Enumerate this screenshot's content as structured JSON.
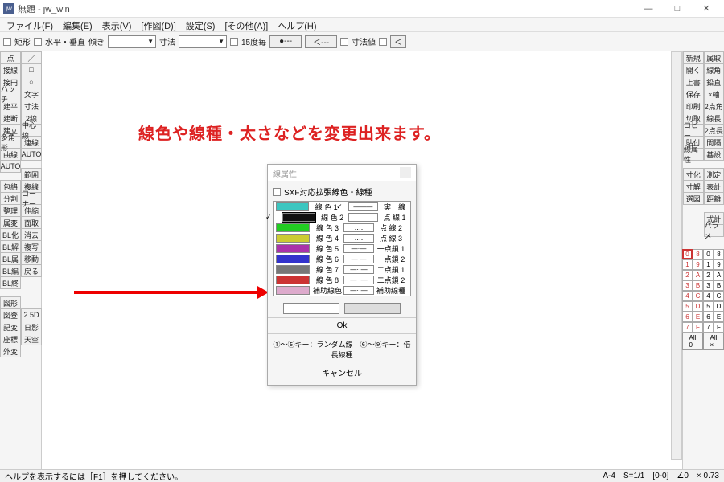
{
  "window": {
    "icon": "jw",
    "title": "無題 - jw_win"
  },
  "menu": [
    "ファイル(F)",
    "編集(E)",
    "表示(V)",
    "[作図(D)]",
    "設定(S)",
    "[その他(A)]",
    "ヘルプ(H)"
  ],
  "optbar": {
    "rect": "矩形",
    "hv": "水平・垂直",
    "slope": "傾き",
    "dim": "寸法",
    "deg15": "15度毎",
    "dimval": "寸法値"
  },
  "left_a": [
    "点",
    "接線",
    "接円",
    "ハッチ",
    "建平",
    "建断",
    "建立",
    "多角形",
    "曲線",
    "AUTO",
    "",
    "包絡",
    "分割",
    "整理",
    "属変",
    "BL化",
    "BL解",
    "BL属",
    "BL編",
    "BL終",
    "",
    "図形",
    "図登",
    "記変",
    "座標",
    "外変"
  ],
  "left_b": [
    "／",
    "□",
    "○",
    "文字",
    "寸法",
    "2線",
    "中心線",
    "連線",
    "AUTO",
    "",
    "範囲",
    "複線",
    "コーナー",
    "伸縮",
    "面取",
    "消去",
    "複写",
    "移動",
    "戻る",
    "",
    "",
    "",
    "",
    "2.5D",
    "日影",
    "天空"
  ],
  "right_a": [
    "新規",
    "開く",
    "上書",
    "保存",
    "印刷",
    "切取",
    "コピー",
    "貼付",
    "線属性",
    "",
    "寸化",
    "寸解",
    "選図",
    "",
    "",
    "",
    "",
    "",
    "",
    "",
    ""
  ],
  "right_b": [
    "属取",
    "線角",
    "鉛直",
    "×軸",
    "2点角",
    "線長",
    "2点長",
    "間隔",
    "基設",
    "",
    "測定",
    "表計",
    "距離",
    "",
    "式計",
    "パラメ"
  ],
  "highlight_idx": 20,
  "headline": "線色や線種・太さなどを変更出来ます。",
  "dialog": {
    "title": "線属性",
    "sxf": "SXF対応拡張線色・線種",
    "colors": [
      {
        "c": "#3cc6c0",
        "n": "線 色 1",
        "lt": "実　線"
      },
      {
        "c": "#111",
        "n": "線 色 2",
        "lt": "点 線 1"
      },
      {
        "c": "#2c2",
        "n": "線 色 3",
        "lt": "点 線 2"
      },
      {
        "c": "#cc3",
        "n": "線 色 4",
        "lt": "点 線 3"
      },
      {
        "c": "#a3a",
        "n": "線 色 5",
        "lt": "一点鎖 1"
      },
      {
        "c": "#33c",
        "n": "線 色 6",
        "lt": "一点鎖 2"
      },
      {
        "c": "#777",
        "n": "線 色 7",
        "lt": "二点鎖 1"
      },
      {
        "c": "#c33",
        "n": "線 色 8",
        "lt": "二点鎖 2"
      },
      {
        "c": "#dac",
        "n": "補助線色",
        "lt": "補助線種"
      }
    ],
    "ok": "Ok",
    "hint": "①～⑤キー：ランダム線　⑥～⑨キー：倍長線種",
    "cancel": "キャンセル"
  },
  "layers": {
    "left": [
      [
        "0",
        "8"
      ],
      [
        "1",
        "9"
      ],
      [
        "2",
        "A"
      ],
      [
        "3",
        "B"
      ],
      [
        "4",
        "C"
      ],
      [
        "5",
        "D"
      ],
      [
        "6",
        "E"
      ],
      [
        "7",
        "F"
      ]
    ],
    "all_l": "All",
    "all_l2": "0",
    "all_r": "All",
    "all_r2": "×"
  },
  "status": {
    "help": "ヘルプを表示するには［F1］を押してください。",
    "a": "A-4",
    "s": "S=1/1",
    "o": "[0-0]",
    "ang": "∠0",
    "zoom": "× 0.73"
  }
}
